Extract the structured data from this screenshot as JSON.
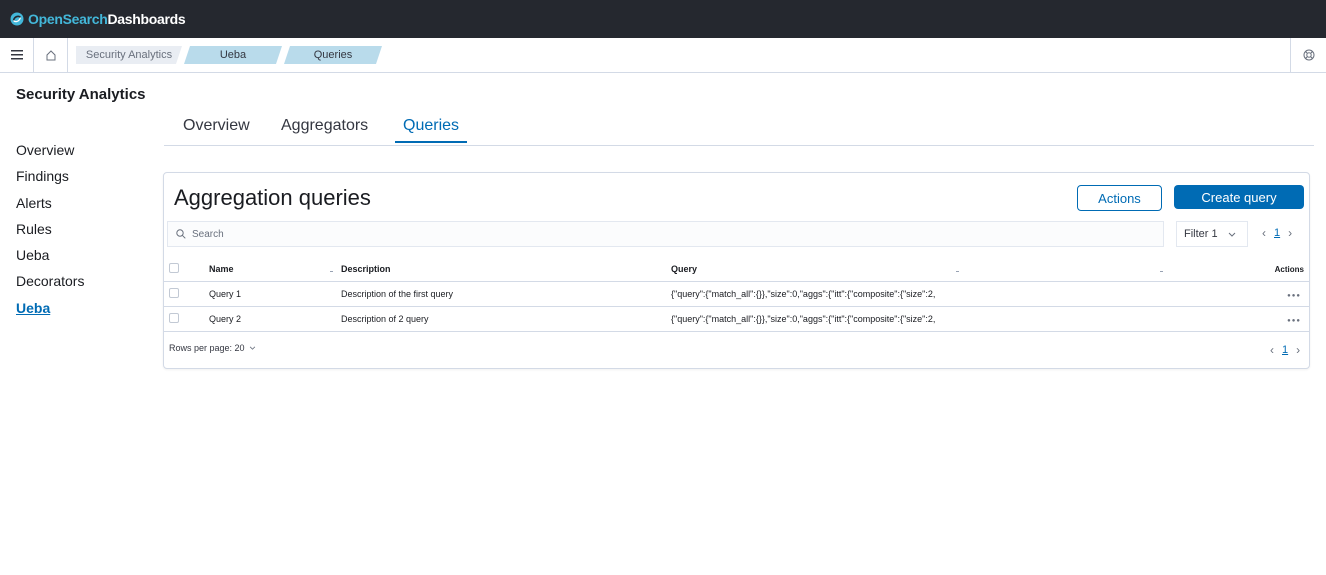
{
  "app": {
    "brand_open": "OpenSearch",
    "brand_rest": "Dashboards"
  },
  "breadcrumbs": [
    "Security Analytics",
    "Ueba",
    "Queries"
  ],
  "sidebar": {
    "title": "Security Analytics",
    "items": [
      {
        "label": "Overview"
      },
      {
        "label": "Findings"
      },
      {
        "label": "Alerts"
      },
      {
        "label": "Rules"
      },
      {
        "label": "Ueba"
      },
      {
        "label": "Decorators"
      },
      {
        "label": "Ueba",
        "active": true
      }
    ]
  },
  "tabs": [
    {
      "label": "Overview"
    },
    {
      "label": "Aggregators"
    },
    {
      "label": "Queries",
      "active": true
    }
  ],
  "panel": {
    "title": "Aggregation queries",
    "actions_label": "Actions",
    "create_label": "Create query",
    "search_placeholder": "Search",
    "filter_label": "Filter 1",
    "page": "1"
  },
  "table": {
    "columns": [
      "Name",
      "Description",
      "Query",
      "Actions"
    ],
    "rows": [
      {
        "name": "Query 1",
        "description": "Description of the first query",
        "query": "{\"query\":{\"match_all\":{}},\"size\":0,\"aggs\":{\"itt\":{\"composite\":{\"size\":2,"
      },
      {
        "name": "Query 2",
        "description": "Description of 2 query",
        "query": "{\"query\":{\"match_all\":{}},\"size\":0,\"aggs\":{\"itt\":{\"composite\":{\"size\":2,"
      }
    ]
  },
  "footer": {
    "rows_per_page": "Rows per page: 20",
    "page": "1"
  },
  "colors": {
    "header_bg": "#25282f",
    "brand_accent": "#43b7d9",
    "primary": "#006bb4",
    "crumb_active": "#b9dbeb"
  }
}
